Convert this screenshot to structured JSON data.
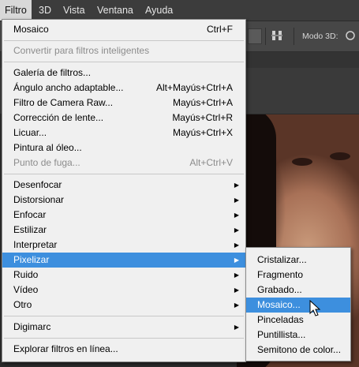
{
  "menubar": {
    "items": [
      {
        "label": "Filtro",
        "active": true
      },
      {
        "label": "3D"
      },
      {
        "label": "Vista"
      },
      {
        "label": "Ventana"
      },
      {
        "label": "Ayuda"
      }
    ]
  },
  "toolbar": {
    "mode_label": "Modo 3D:"
  },
  "menu": {
    "rows": [
      {
        "label": "Mosaico",
        "shortcut": "Ctrl+F"
      },
      {
        "label": "Convertir para filtros inteligentes",
        "disabled": true
      },
      {
        "label": "Galería de filtros..."
      },
      {
        "label": "Ángulo ancho adaptable...",
        "shortcut": "Alt+Mayús+Ctrl+A"
      },
      {
        "label": "Filtro de Camera Raw...",
        "shortcut": "Mayús+Ctrl+A"
      },
      {
        "label": "Corrección de lente...",
        "shortcut": "Mayús+Ctrl+R"
      },
      {
        "label": "Licuar...",
        "shortcut": "Mayús+Ctrl+X"
      },
      {
        "label": "Pintura al óleo..."
      },
      {
        "label": "Punto de fuga...",
        "shortcut": "Alt+Ctrl+V",
        "disabled": true
      },
      {
        "label": "Desenfocar",
        "submenu": true
      },
      {
        "label": "Distorsionar",
        "submenu": true
      },
      {
        "label": "Enfocar",
        "submenu": true
      },
      {
        "label": "Estilizar",
        "submenu": true
      },
      {
        "label": "Interpretar",
        "submenu": true
      },
      {
        "label": "Pixelizar",
        "submenu": true,
        "highlighted": true
      },
      {
        "label": "Ruido",
        "submenu": true
      },
      {
        "label": "Vídeo",
        "submenu": true
      },
      {
        "label": "Otro",
        "submenu": true
      },
      {
        "label": "Digimarc",
        "submenu": true
      },
      {
        "label": "Explorar filtros en línea..."
      }
    ]
  },
  "submenu": {
    "items": [
      {
        "label": "Cristalizar..."
      },
      {
        "label": "Fragmento"
      },
      {
        "label": "Grabado..."
      },
      {
        "label": "Mosaico...",
        "highlighted": true
      },
      {
        "label": "Pinceladas"
      },
      {
        "label": "Puntillista..."
      },
      {
        "label": "Semitono de color..."
      }
    ]
  },
  "icons": {
    "submenu_arrow": "chevron-right-icon",
    "cursor": "mouse-pointer-icon"
  },
  "colors": {
    "highlight": "#3d8fde",
    "menu_bg": "#f0f0f0",
    "menubar_bg": "#3c3c3c"
  }
}
